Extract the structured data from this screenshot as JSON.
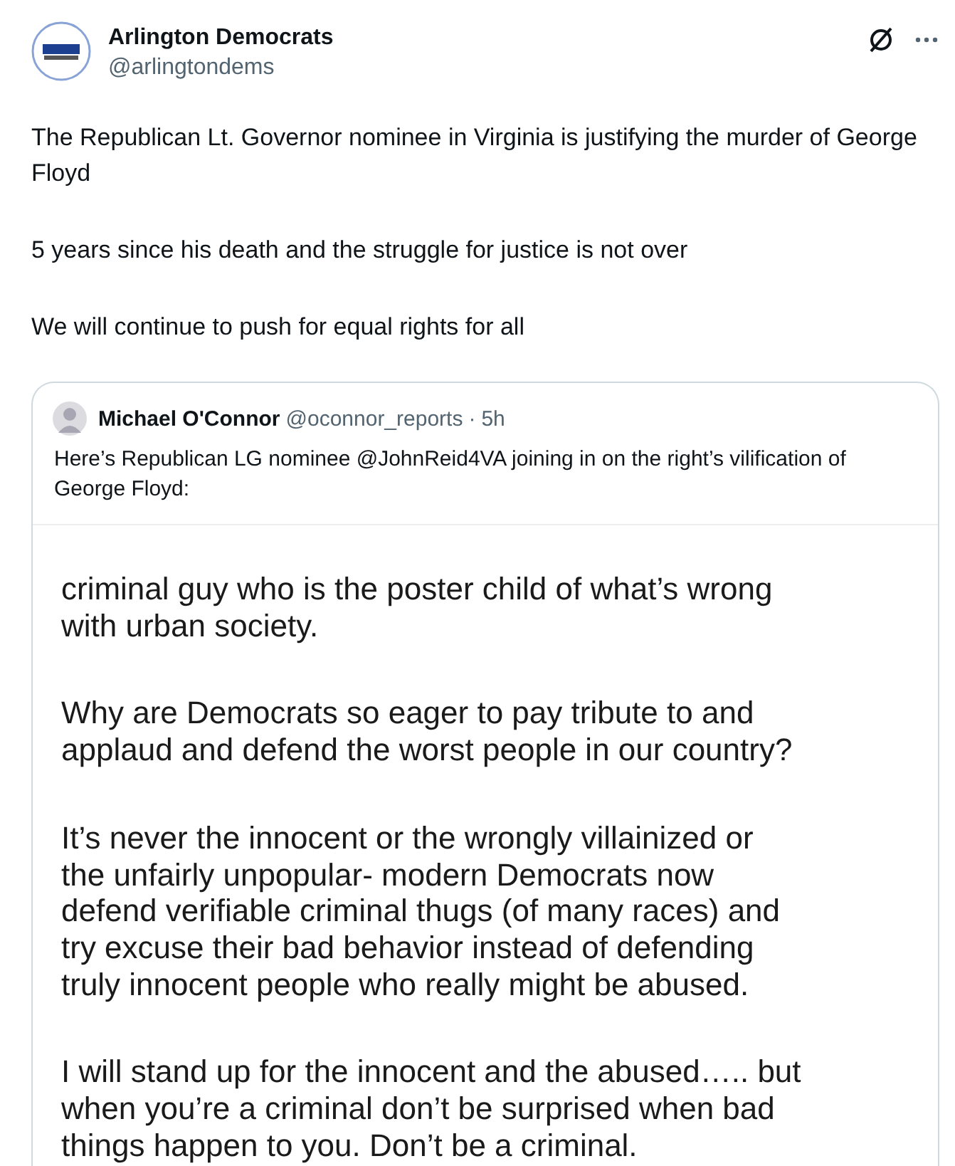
{
  "author": {
    "name": "Arlington Democrats",
    "handle": "@arlingtondems"
  },
  "paragraphs": [
    "The Republican Lt. Governor nominee in Virginia is justifying the murder of George Floyd",
    "5 years since his death and the struggle for justice is not over",
    "We will continue to push for equal rights for all"
  ],
  "quote": {
    "name": "Michael O'Connor",
    "handle": "@oconnor_reports",
    "separator": "·",
    "time": "5h",
    "text": "Here’s Republican LG nominee @JohnReid4VA joining in on the right’s vilification of George Floyd:",
    "image_paragraphs": [
      [
        "criminal guy who is the poster child of what’s wrong",
        "with urban society."
      ],
      [
        "Why are Democrats so eager to pay tribute to and",
        "applaud and defend the worst people in our country?"
      ],
      [
        "It’s never the innocent or the wrongly villainized or",
        "the unfairly unpopular- modern Democrats now",
        "defend verifiable criminal thugs (of many races) and",
        "try excuse their bad behavior instead of defending",
        "truly innocent people who really might be abused."
      ],
      [
        "I will stand up for the innocent and the abused….. but",
        "when you’re a criminal don’t be surprised when bad",
        "things happen to you. Don’t be a criminal."
      ]
    ]
  }
}
